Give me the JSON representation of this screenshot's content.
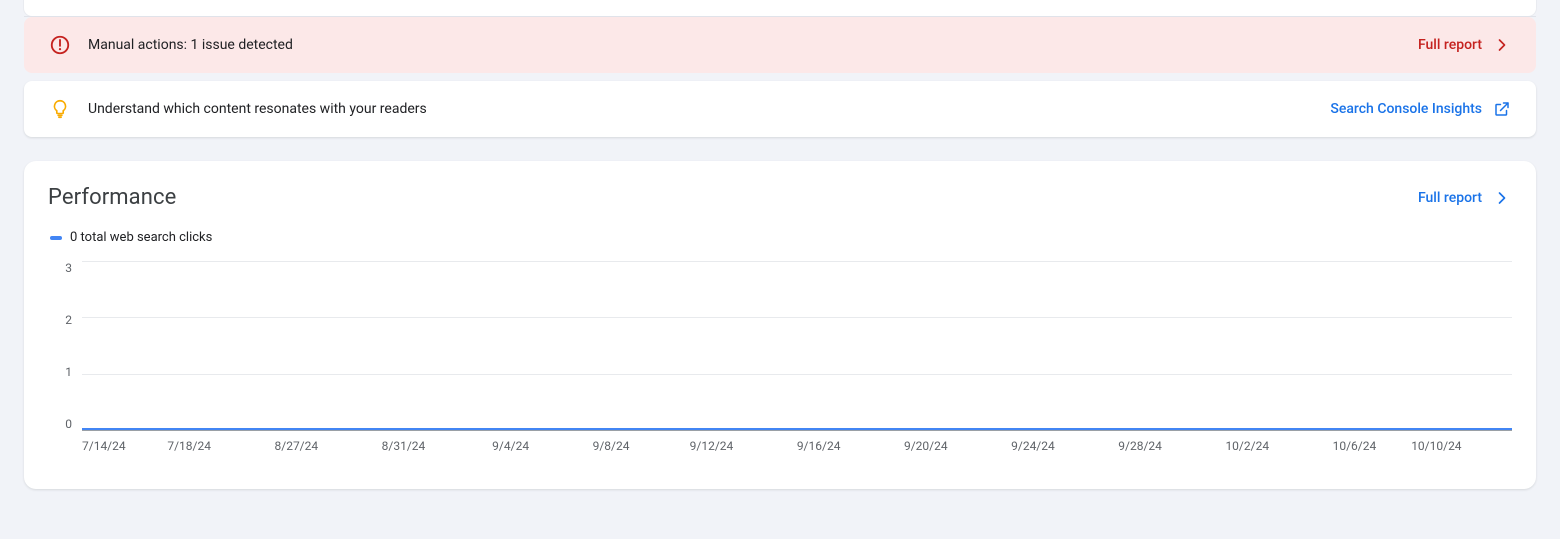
{
  "alerts": {
    "manual_actions": {
      "message": "Manual actions: 1 issue detected",
      "action_label": "Full report"
    },
    "insights_tip": {
      "message": "Understand which content resonates with your readers",
      "action_label": "Search Console Insights"
    }
  },
  "performance": {
    "title": "Performance",
    "full_report_label": "Full report",
    "legend_label": "0 total web search clicks"
  },
  "chart_data": {
    "type": "line",
    "title": "Performance",
    "xlabel": "",
    "ylabel": "",
    "ylim": [
      0,
      3
    ],
    "y_ticks": [
      3,
      2,
      1,
      0
    ],
    "x_ticks": [
      "7/14/24",
      "7/18/24",
      "8/27/24",
      "8/31/24",
      "9/4/24",
      "9/8/24",
      "9/12/24",
      "9/16/24",
      "9/20/24",
      "9/24/24",
      "9/28/24",
      "10/2/24",
      "10/6/24",
      "10/10/24"
    ],
    "series": [
      {
        "name": "total web search clicks",
        "color": "#4285f4",
        "x": [
          "7/14/24",
          "7/18/24",
          "8/27/24",
          "8/31/24",
          "9/4/24",
          "9/8/24",
          "9/12/24",
          "9/16/24",
          "9/20/24",
          "9/24/24",
          "9/28/24",
          "10/2/24",
          "10/6/24",
          "10/10/24"
        ],
        "values": [
          0,
          0,
          0,
          0,
          0,
          0,
          0,
          0,
          0,
          0,
          0,
          0,
          0,
          0
        ]
      }
    ]
  }
}
